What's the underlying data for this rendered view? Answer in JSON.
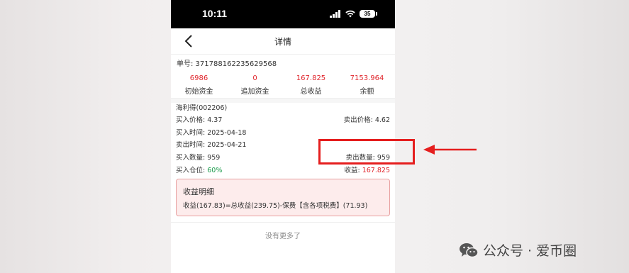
{
  "status_bar": {
    "time": "10:11",
    "battery": "35"
  },
  "header": {
    "title": "详情"
  },
  "order": {
    "number_label": "单号: 371788162235629568"
  },
  "stats": [
    {
      "value": "6986",
      "label": "初始资金"
    },
    {
      "value": "0",
      "label": "追加资金"
    },
    {
      "value": "167.825",
      "label": "总收益"
    },
    {
      "value": "7153.964",
      "label": "余额"
    }
  ],
  "stock": {
    "name": "海利得(002206)",
    "buy_price": "买入价格: 4.37",
    "sell_price_label": "卖出价格: ",
    "sell_price_value": "4.62",
    "buy_time": "买入时间: 2025-04-18",
    "sell_time": "卖出时间: 2025-04-21",
    "buy_qty": "买入数量: 959",
    "sell_qty": "卖出数量: 959",
    "position_label": "买入仓位: ",
    "position_value": "60%",
    "profit_label": "收益: ",
    "profit_value": "167.825"
  },
  "profit_detail": {
    "title": "收益明细",
    "formula": "收益(167.83)=总收益(239.75)-保费【含各项税费】(71.93)"
  },
  "footer": {
    "no_more": "没有更多了"
  },
  "watermark": {
    "text": "公众号 · 爱币圈"
  },
  "colors": {
    "profit_red": "#e0242b",
    "position_green": "#1a9a4a",
    "annotation_red": "#e51e1e"
  }
}
